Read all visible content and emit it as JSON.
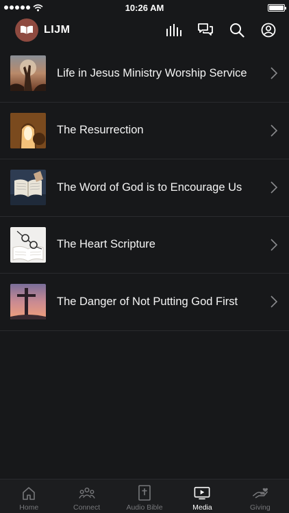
{
  "status_bar": {
    "time": "10:26 AM",
    "signal_icon": "signal-dots-icon",
    "wifi_icon": "wifi-icon",
    "battery_level": 1.0
  },
  "header": {
    "brand": "LIJM",
    "logo_icon": "open-book-logo-icon",
    "accent_color": "#8e4a40",
    "icons": [
      "audio-bars-icon",
      "chat-bubbles-icon",
      "search-icon",
      "profile-icon"
    ]
  },
  "media": {
    "items": [
      {
        "title": "Life in Jesus Ministry Worship Service",
        "thumb": "worship-hands-thumbnail"
      },
      {
        "title": "The Resurrection",
        "thumb": "empty-tomb-thumbnail"
      },
      {
        "title": "The Word of God is to Encourage Us",
        "thumb": "open-bible-thumbnail"
      },
      {
        "title": "The Heart Scripture",
        "thumb": "glasses-on-book-thumbnail"
      },
      {
        "title": "The Danger of Not Putting God First",
        "thumb": "cross-sunset-thumbnail"
      }
    ]
  },
  "tabs": [
    {
      "label": "Home",
      "icon": "home-icon",
      "active": false
    },
    {
      "label": "Connect",
      "icon": "people-group-icon",
      "active": false
    },
    {
      "label": "Audio Bible",
      "icon": "bible-icon",
      "active": false
    },
    {
      "label": "Media",
      "icon": "play-screen-icon",
      "active": true
    },
    {
      "label": "Giving",
      "icon": "giving-hand-icon",
      "active": false
    }
  ]
}
